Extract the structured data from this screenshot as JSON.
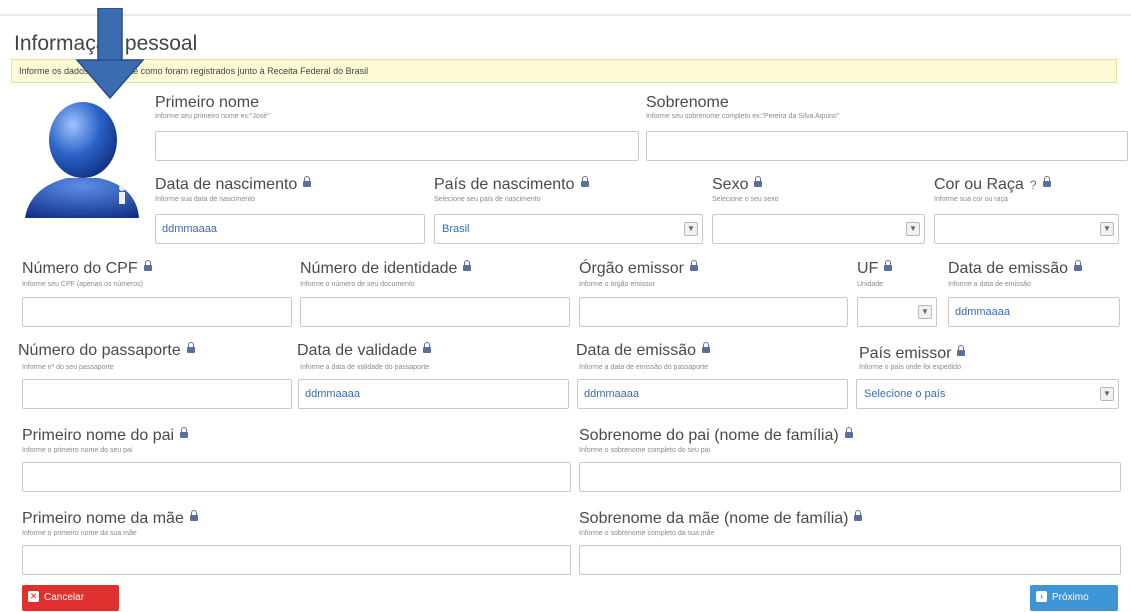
{
  "section_title": "Informação pessoal",
  "notice": "Informe os dados exatamente como foram registrados junto à Receita Federal do Brasil",
  "colors": {
    "notice_bg": "#fdfbd6",
    "arrow": "#3b6cb0",
    "label_link": "#3a6bb5",
    "cancel": "#e02f2f",
    "next": "#3d95d6"
  },
  "fields": {
    "primeiro_nome": {
      "label": "Primeiro nome",
      "hint": "Informe seu primeiro nome ex:\"José\"",
      "value": ""
    },
    "sobrenome": {
      "label": "Sobrenome",
      "hint": "Informe seu sobrenome completo ex:\"Pereira da Silva Aquino\"",
      "value": ""
    },
    "data_nascimento": {
      "label": "Data de nascimento",
      "hint": "Informe sua data de nascimento",
      "placeholder": "ddmmaaaa"
    },
    "pais_nascimento": {
      "label": "País de nascimento",
      "hint": "Selecione seu país de nascimento",
      "value": "Brasil"
    },
    "sexo": {
      "label": "Sexo",
      "hint": "Selecione o seu sexo",
      "value": ""
    },
    "cor_raca": {
      "label": "Cor ou Raça",
      "hint": "Informe sua cor ou raça",
      "help": "?",
      "value": ""
    },
    "cpf": {
      "label": "Número do CPF",
      "hint": "Informe seu CPF (apenas os números)",
      "value": ""
    },
    "identidade": {
      "label": "Número de identidade",
      "hint": "Informe o número de seu documento",
      "value": ""
    },
    "orgao_emissor": {
      "label": "Órgão emissor",
      "hint": "Informe o órgão emissor",
      "value": ""
    },
    "uf": {
      "label": "UF",
      "hint": "Unidade",
      "value": ""
    },
    "data_emissao": {
      "label": "Data de emissão",
      "hint": "Informe a data de emissão",
      "placeholder": "ddmmaaaa"
    },
    "passaporte": {
      "label": "Número do passaporte",
      "hint": "Informe nº do seu passaporte",
      "value": ""
    },
    "data_validade": {
      "label": "Data de validade",
      "hint": "Informe a data de validade do passaporte",
      "placeholder": "ddmmaaaa"
    },
    "data_emissao_passaporte": {
      "label": "Data de emissão",
      "hint": "Informe a data de emissão do passaporte",
      "placeholder": "ddmmaaaa"
    },
    "pais_emissor": {
      "label": "País emissor",
      "hint": "Informe o país onde foi expedido",
      "value": "Selecione o país"
    },
    "primeiro_nome_pai": {
      "label": "Primeiro nome do pai",
      "hint": "Informe o primeiro nome do seu pai",
      "value": ""
    },
    "sobrenome_pai": {
      "label": "Sobrenome do pai (nome de família)",
      "hint": "Informe o sobrenome completo do seu pai",
      "value": ""
    },
    "primeiro_nome_mae": {
      "label": "Primeiro nome da mãe",
      "hint": "Informe o primeiro nome da sua mãe",
      "value": ""
    },
    "sobrenome_mae": {
      "label": "Sobrenome da mãe (nome de família)",
      "hint": "Informe o sobrenome completo da sua mãe",
      "value": ""
    }
  },
  "buttons": {
    "cancel": "Cancelar",
    "next": "Próximo"
  }
}
